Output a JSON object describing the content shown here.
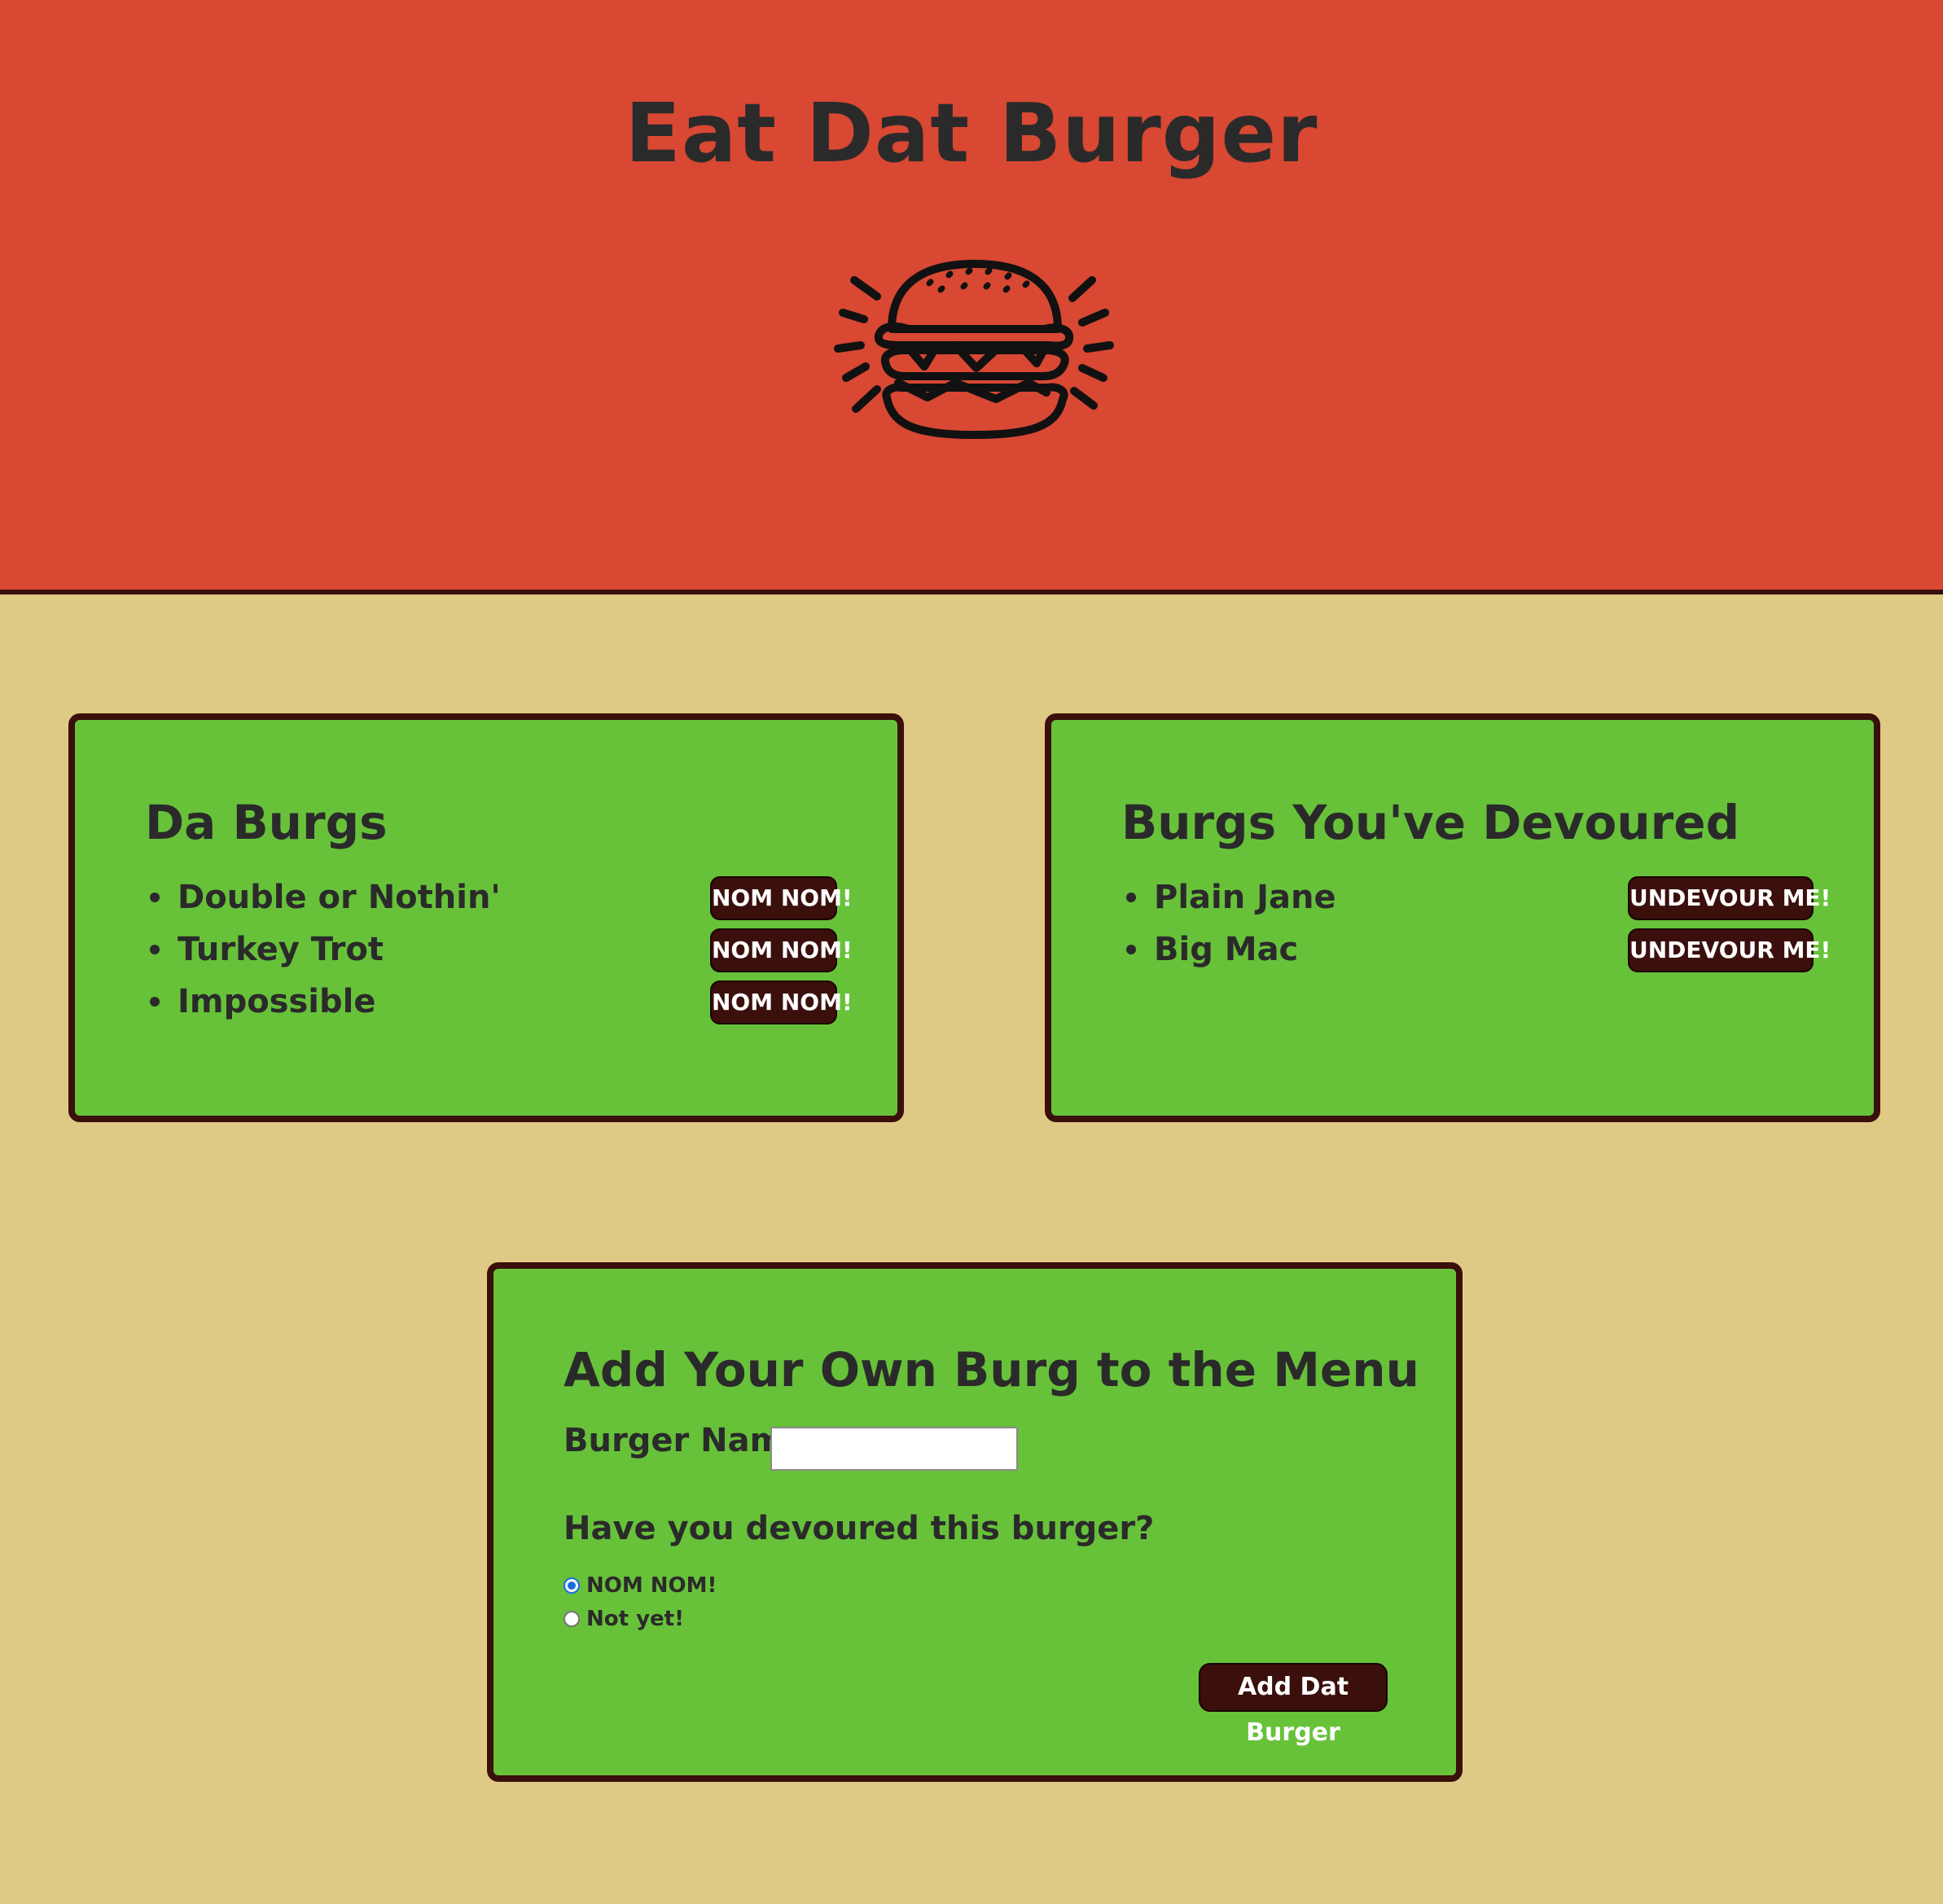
{
  "header": {
    "title": "Eat Dat Burger",
    "logo_icon": "burger-icon",
    "background_color": "#d84833"
  },
  "page": {
    "background_color": "#dfca85",
    "panel_color": "#67c23a",
    "button_color": "#3b0f0c"
  },
  "burgers_panel": {
    "title": "Da Burgs",
    "items": [
      {
        "name": "Double or Nothin'",
        "button_label": "NOM NOM!"
      },
      {
        "name": "Turkey Trot",
        "button_label": "NOM NOM!"
      },
      {
        "name": "Impossible",
        "button_label": "NOM NOM!"
      }
    ]
  },
  "devoured_panel": {
    "title": "Burgs You've Devoured",
    "items": [
      {
        "name": "Plain Jane",
        "button_label": "UNDEVOUR ME!"
      },
      {
        "name": "Big Mac",
        "button_label": "UNDEVOUR ME!"
      }
    ]
  },
  "add_form": {
    "title": "Add Your Own Burg to the Menu",
    "name_label": "Burger Name:",
    "name_value": "",
    "question": "Have you devoured this burger?",
    "options": [
      {
        "label": "NOM NOM!",
        "checked": true
      },
      {
        "label": "Not yet!",
        "checked": false
      }
    ],
    "submit_label": "Add Dat Burger"
  }
}
